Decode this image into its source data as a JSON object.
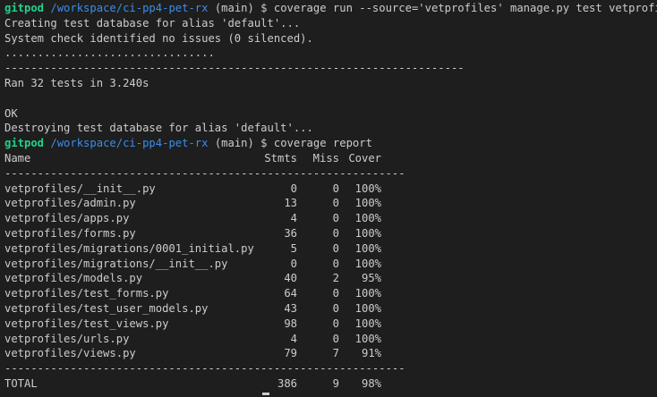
{
  "prompt1": {
    "user": "gitpod",
    "path": "/workspace/ci-pp4-pet-rx",
    "suffix": " (main) $ coverage run --source='vetprofiles' manage.py test vetprofiles"
  },
  "output1": {
    "creating": "Creating test database for alias 'default'...",
    "system_check": "System check identified no issues (0 silenced).",
    "dots": "................................",
    "separator": "----------------------------------------------------------------------",
    "ran": "Ran 32 tests in 3.240s",
    "ok": "OK",
    "destroying": "Destroying test database for alias 'default'..."
  },
  "prompt2": {
    "user": "gitpod",
    "path": "/workspace/ci-pp4-pet-rx",
    "suffix": " (main) $ coverage report"
  },
  "report": {
    "headers": {
      "name": "Name",
      "stmts": "Stmts",
      "miss": "Miss",
      "cover": "Cover"
    },
    "separator": "-------------------------------------------------------------",
    "rows": [
      {
        "name": "vetprofiles/__init__.py",
        "stmts": "0",
        "miss": "0",
        "cover": "100%"
      },
      {
        "name": "vetprofiles/admin.py",
        "stmts": "13",
        "miss": "0",
        "cover": "100%"
      },
      {
        "name": "vetprofiles/apps.py",
        "stmts": "4",
        "miss": "0",
        "cover": "100%"
      },
      {
        "name": "vetprofiles/forms.py",
        "stmts": "36",
        "miss": "0",
        "cover": "100%"
      },
      {
        "name": "vetprofiles/migrations/0001_initial.py",
        "stmts": "5",
        "miss": "0",
        "cover": "100%"
      },
      {
        "name": "vetprofiles/migrations/__init__.py",
        "stmts": "0",
        "miss": "0",
        "cover": "100%"
      },
      {
        "name": "vetprofiles/models.py",
        "stmts": "40",
        "miss": "2",
        "cover": "95%"
      },
      {
        "name": "vetprofiles/test_forms.py",
        "stmts": "64",
        "miss": "0",
        "cover": "100%"
      },
      {
        "name": "vetprofiles/test_user_models.py",
        "stmts": "43",
        "miss": "0",
        "cover": "100%"
      },
      {
        "name": "vetprofiles/test_views.py",
        "stmts": "98",
        "miss": "0",
        "cover": "100%"
      },
      {
        "name": "vetprofiles/urls.py",
        "stmts": "4",
        "miss": "0",
        "cover": "100%"
      },
      {
        "name": "vetprofiles/views.py",
        "stmts": "79",
        "miss": "7",
        "cover": "91%"
      }
    ],
    "total": {
      "name": "TOTAL",
      "stmts": "386",
      "miss": "9",
      "cover": "98%"
    }
  },
  "colors": {
    "background": "#1e1e1e",
    "text": "#cccccc",
    "prompt_user": "#23d18b",
    "prompt_path": "#3b8eea"
  }
}
